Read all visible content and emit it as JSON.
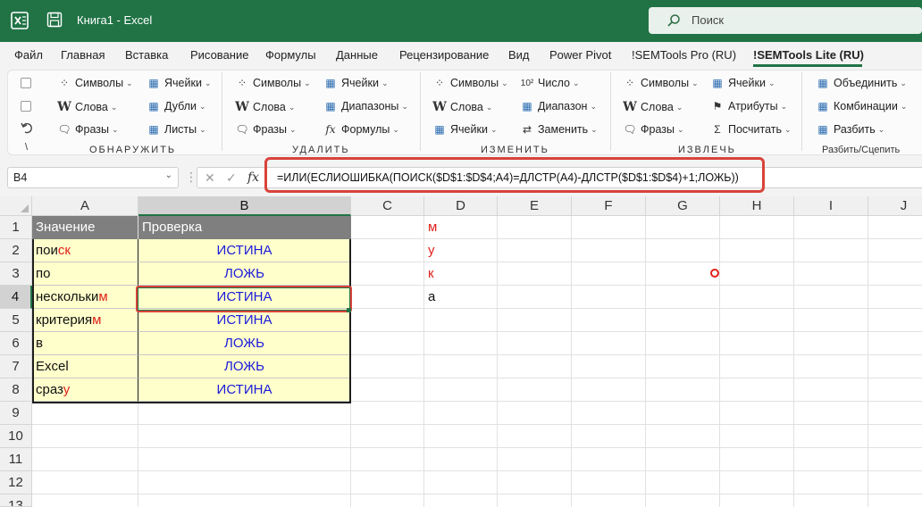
{
  "titlebar": {
    "app_title": "Книга1  -  Excel",
    "search_placeholder": "Поиск",
    "bg_color": "#217346"
  },
  "tabs": [
    {
      "label": "Файл"
    },
    {
      "label": "Главная"
    },
    {
      "label": "Вставка"
    },
    {
      "label": "Рисование"
    },
    {
      "label": "Формулы"
    },
    {
      "label": "Данные"
    },
    {
      "label": "Рецензирование"
    },
    {
      "label": "Вид"
    },
    {
      "label": "Power Pivot"
    },
    {
      "label": "!SEMTools Pro (RU)"
    },
    {
      "label": "!SEMTools Lite (RU)",
      "active": true
    }
  ],
  "ribbon": {
    "groups": [
      {
        "name": "ОБНАРУЖИТЬ",
        "items": [
          "Символы",
          "Ячейки",
          "Слова",
          "Дубли",
          "Фразы",
          "Листы"
        ]
      },
      {
        "name": "УДАЛИТЬ",
        "items": [
          "Символы",
          "Ячейки",
          "Слова",
          "Диапазоны",
          "Фразы",
          "Формулы"
        ]
      },
      {
        "name": "ИЗМЕНИТЬ",
        "items": [
          "Символы",
          "Число",
          "Слова",
          "Диапазон",
          "Ячейки",
          "Заменить"
        ]
      },
      {
        "name": "ИЗВЛЕЧЬ",
        "items": [
          "Символы",
          "Ячейки",
          "Слова",
          "Атрибуты",
          "Фразы",
          "Посчитать"
        ]
      },
      {
        "name": "Разбить/Сцепить",
        "items": [
          "Объединить",
          "Комбинации",
          "Разбить"
        ]
      }
    ],
    "left_col_glyph": "\\"
  },
  "formula_bar": {
    "name_box": "B4",
    "fx": "fx",
    "formula": "=ИЛИ(ЕСЛИОШИБКА(ПОИСК($D$1:$D$4;A4)=ДЛСТР(A4)-ДЛСТР($D$1:$D$4)+1;ЛОЖЬ))"
  },
  "grid": {
    "columns": [
      "A",
      "B",
      "C",
      "D",
      "E",
      "F",
      "G",
      "H",
      "I",
      "J"
    ],
    "rows": [
      "1",
      "2",
      "3",
      "4",
      "5",
      "6",
      "7",
      "8",
      "9",
      "10",
      "11",
      "12",
      "13"
    ],
    "selected_cell": "B4",
    "header": {
      "a": "Значение",
      "b": "Проверка"
    },
    "data": [
      {
        "a_main": "пои",
        "a_red": "ск",
        "b": "ИСТИНА"
      },
      {
        "a_main": "по",
        "a_red": "",
        "b": "ЛОЖЬ"
      },
      {
        "a_main": "нескольки",
        "a_red": "м",
        "b": "ИСТИНА"
      },
      {
        "a_main": "критерия",
        "a_red": "м",
        "b": "ИСТИНА"
      },
      {
        "a_main": "в",
        "a_red": "",
        "b": "ЛОЖЬ"
      },
      {
        "a_main": "Excel",
        "a_red": "",
        "b": "ЛОЖЬ"
      },
      {
        "a_main": "сраз",
        "a_red": "у",
        "b": "ИСТИНА"
      }
    ],
    "column_d": [
      {
        "value": "м",
        "red": true
      },
      {
        "value": "у",
        "red": true
      },
      {
        "value": "к",
        "red": true
      },
      {
        "value": "а",
        "red": false
      }
    ]
  },
  "colors": {
    "excel_green": "#217346",
    "highlight_red": "#d9433b",
    "cell_yellow": "#ffffcc",
    "header_gray": "#7f7f7f",
    "bool_blue": "#1a1adb"
  }
}
